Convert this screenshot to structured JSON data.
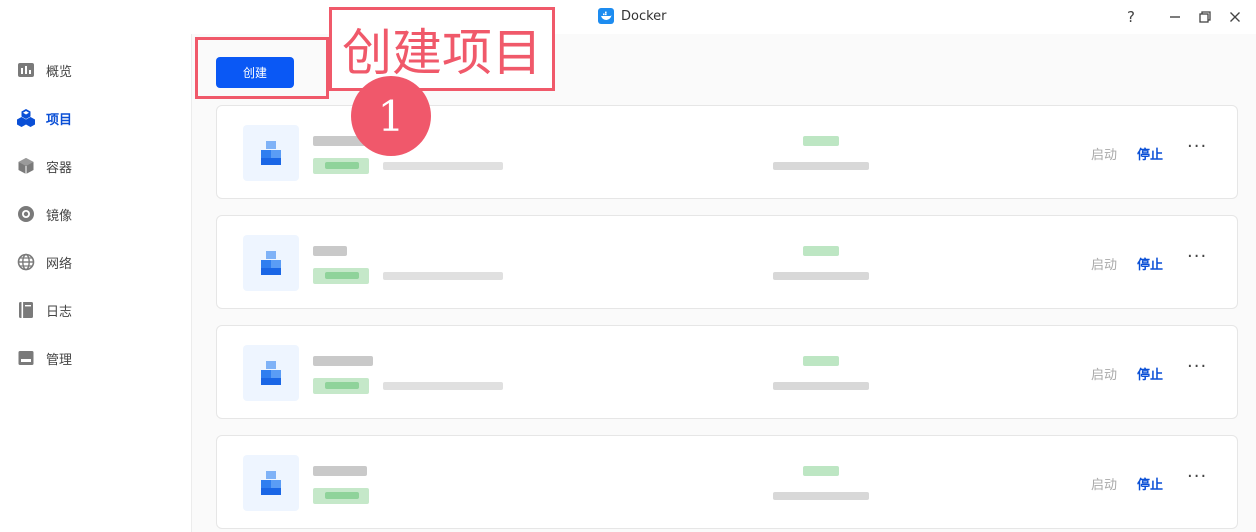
{
  "titlebar": {
    "app_title": "Docker",
    "help_label": "?",
    "icons": [
      "docker-logo-icon",
      "help-icon",
      "minimize-icon",
      "restore-icon",
      "close-icon"
    ]
  },
  "sidebar": {
    "items": [
      {
        "label": "概览",
        "icon": "overview-chart-icon",
        "active": false
      },
      {
        "label": "项目",
        "icon": "project-cubes-icon",
        "active": true
      },
      {
        "label": "容器",
        "icon": "container-box-icon",
        "active": false
      },
      {
        "label": "镜像",
        "icon": "image-disc-icon",
        "active": false
      },
      {
        "label": "网络",
        "icon": "network-globe-icon",
        "active": false
      },
      {
        "label": "日志",
        "icon": "log-book-icon",
        "active": false
      },
      {
        "label": "管理",
        "icon": "manage-icon",
        "active": false
      }
    ]
  },
  "main": {
    "create_label": "创建",
    "projects": [
      {
        "start_label": "启动",
        "stop_label": "停止",
        "more_label": "···"
      },
      {
        "start_label": "启动",
        "stop_label": "停止",
        "more_label": "···"
      },
      {
        "start_label": "启动",
        "stop_label": "停止",
        "more_label": "···"
      },
      {
        "start_label": "启动",
        "stop_label": "停止",
        "more_label": "···"
      }
    ]
  },
  "annotation": {
    "label": "创建项目",
    "step_number": "1",
    "color": "#f0596a"
  },
  "colors": {
    "accent": "#0a58f5",
    "active_nav": "#0a4fd6",
    "disabled_action": "#a9a9a9"
  }
}
